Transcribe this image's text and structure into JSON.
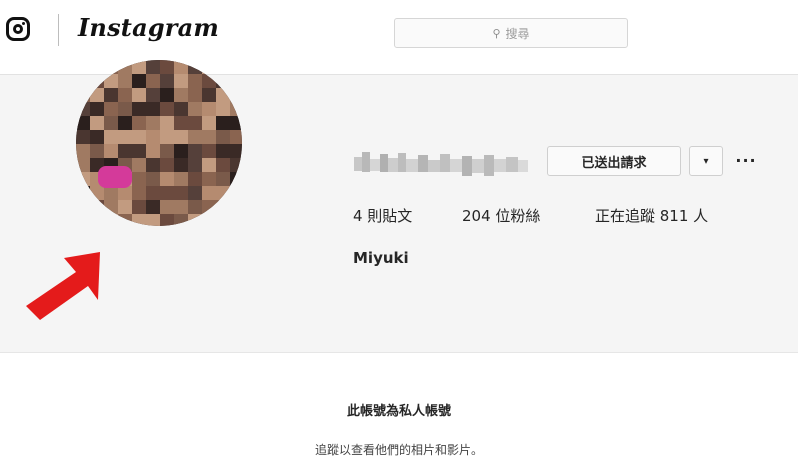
{
  "nav": {
    "brand": "Instagram",
    "search": {
      "placeholder": "搜尋",
      "icon": "search-icon"
    }
  },
  "profile": {
    "username": "",
    "request_button": "已送出請求",
    "dropdown_icon": "▾",
    "more_icon": "···",
    "stats": {
      "posts": "4 則貼文",
      "followers": "204 位粉絲",
      "following": "正在追蹤 811 人"
    },
    "full_name": "Miyuki",
    "annotation": {
      "icon": "red-arrow-icon",
      "color": "#e41b1b"
    }
  },
  "private_notice": {
    "title": "此帳號為私人帳號",
    "subtitle": "追蹤以查看他們的相片和影片。"
  },
  "colors": {
    "profile_bg": "#f5f5f5",
    "text": "#262626",
    "border": "#cfcfcf",
    "arrow": "#e41b1b"
  }
}
